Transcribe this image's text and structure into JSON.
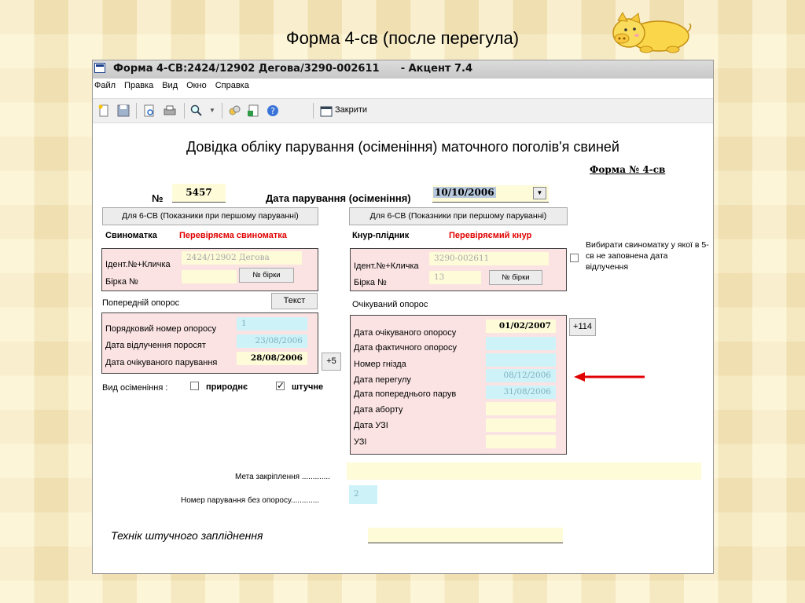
{
  "slide": {
    "title": "Форма 4-св (после перегула)"
  },
  "window": {
    "title": "Форма 4-СВ:2424/12902 Дегова/3290-002611      - Акцент 7.4",
    "menu": [
      "Файл",
      "Правка",
      "Вид",
      "Окно",
      "Справка"
    ],
    "toolbar": {
      "icons": [
        "new-doc-icon",
        "save-icon",
        "preview-icon",
        "print-icon",
        "search-icon",
        "dropdown-icon",
        "tools-icon",
        "table-icon",
        "help-icon",
        "close-doc-icon"
      ],
      "close_label": "Закрити"
    }
  },
  "form": {
    "heading": "Довідка обліку парування (осіменіння) маточного поголів'я свиней",
    "form_link": "Форма № 4-св",
    "number_label": "№",
    "number_value": "5457",
    "date_label": "Дата парування (осіменіння)",
    "date_value": "10/10/2006",
    "btn_sow_first": "Для 6-СВ (Показники при першому паруванні)",
    "btn_boar_first": "Для 6-СВ (Показники при першому паруванні)",
    "sow": {
      "label": "Свиноматка",
      "status": "Перевіряєма свиноматка",
      "id_label": "Ідент.№+Кличка",
      "id_value": "2424/12902 Дегова",
      "tag_label": "Бірка №",
      "tag_value": "",
      "tag_button": "№ бірки"
    },
    "boar": {
      "label": "Кнур-плідник",
      "status": "Перевіряємий кнур",
      "id_label": "Ідент.№+Кличка",
      "id_value": "3290-002611",
      "tag_label": "Бірка №",
      "tag_value": "13",
      "tag_button": "№ бірки"
    },
    "option_text": "Вибирати свиноматку у якої в 5-св не заповнена дата відлучення",
    "prev_farrowing": {
      "label": "Попередній опорос",
      "text_button": "Текст",
      "rows": [
        {
          "label": "Порядковий номер опоросу",
          "value": "1"
        },
        {
          "label": "Дата відлучення поросят",
          "value": "23/08/2006"
        },
        {
          "label": "Дата очікуваного парування",
          "value": "28/08/2006"
        }
      ],
      "plus_button": "+5"
    },
    "insemination": {
      "label": "Вид осіменіння :",
      "natural": "природнє",
      "natural_checked": false,
      "artificial": "штучне",
      "artificial_checked": true
    },
    "expected_farrowing": {
      "label": "Очікуваний опорос",
      "plus_button": "+114",
      "rows": [
        {
          "label": "Дата очікуваного опоросу",
          "value": "01/02/2007"
        },
        {
          "label": "Дата фактичного опоросу",
          "value": ""
        },
        {
          "label": "Номер гнізда",
          "value": ""
        },
        {
          "label": "Дата перегулу",
          "value": "08/12/2006"
        },
        {
          "label": "Дата попереднього парув",
          "value": "31/08/2006"
        },
        {
          "label": "Дата аборту",
          "value": ""
        },
        {
          "label": "Дата УЗІ",
          "value": ""
        },
        {
          "label": "УЗІ",
          "value": ""
        }
      ]
    },
    "purpose_label": "Мета закріплення .............",
    "purpose_value": "",
    "mating_number_label": "Номер парування без опоросу.............",
    "mating_number_value": "2",
    "technician_label": "Технік штучного запліднення",
    "technician_value": ""
  },
  "colors": {
    "arrow": "#e00000",
    "panel": "#fbe3e3",
    "cyan_field": "#cdf3f9",
    "yellow_field": "#fdfbd8"
  }
}
